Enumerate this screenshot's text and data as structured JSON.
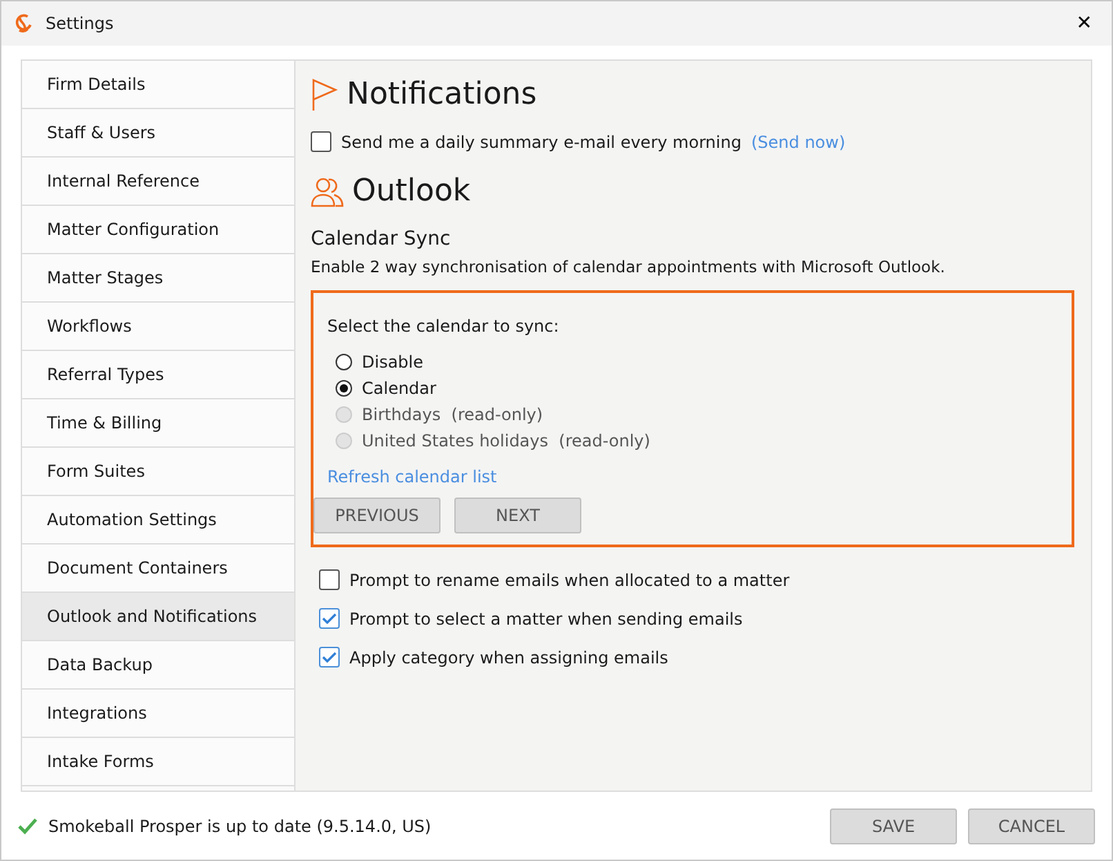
{
  "window": {
    "title": "Settings",
    "close": "✕"
  },
  "sidebar": {
    "items": [
      {
        "label": "Firm Details",
        "selected": false
      },
      {
        "label": "Staff & Users",
        "selected": false
      },
      {
        "label": "Internal Reference",
        "selected": false
      },
      {
        "label": "Matter Configuration",
        "selected": false
      },
      {
        "label": "Matter Stages",
        "selected": false
      },
      {
        "label": "Workflows",
        "selected": false
      },
      {
        "label": "Referral Types",
        "selected": false
      },
      {
        "label": "Time & Billing",
        "selected": false
      },
      {
        "label": "Form Suites",
        "selected": false
      },
      {
        "label": "Automation Settings",
        "selected": false
      },
      {
        "label": "Document Containers",
        "selected": false
      },
      {
        "label": "Outlook and Notifications",
        "selected": true
      },
      {
        "label": "Data Backup",
        "selected": false
      },
      {
        "label": "Integrations",
        "selected": false
      },
      {
        "label": "Intake Forms",
        "selected": false
      }
    ]
  },
  "notifications": {
    "heading": "Notifications",
    "daily_summary": {
      "label": "Send me a daily summary e-mail every morning",
      "checked": false,
      "link": "(Send now)"
    }
  },
  "outlook": {
    "heading": "Outlook",
    "calendar_sync": {
      "title": "Calendar Sync",
      "description": "Enable 2 way synchronisation of calendar appointments with Microsoft Outlook.",
      "prompt": "Select the calendar to sync:",
      "options": [
        {
          "label": "Disable",
          "selected": false,
          "disabled": false
        },
        {
          "label": "Calendar",
          "selected": true,
          "disabled": false
        },
        {
          "label": "Birthdays  (read-only)",
          "selected": false,
          "disabled": true
        },
        {
          "label": "United States holidays  (read-only)",
          "selected": false,
          "disabled": true
        }
      ],
      "refresh_link": "Refresh calendar list",
      "buttons": [
        "PREVIOUS",
        "NEXT"
      ]
    },
    "options": [
      {
        "label": "Prompt to rename emails when allocated to a matter",
        "checked": false
      },
      {
        "label": "Prompt to select a matter when sending emails",
        "checked": true
      },
      {
        "label": "Apply category when assigning emails",
        "checked": true
      }
    ]
  },
  "status": "Smokeball Prosper is up to date (9.5.14.0, US)",
  "footer_buttons": [
    "SAVE",
    "CANCEL"
  ]
}
